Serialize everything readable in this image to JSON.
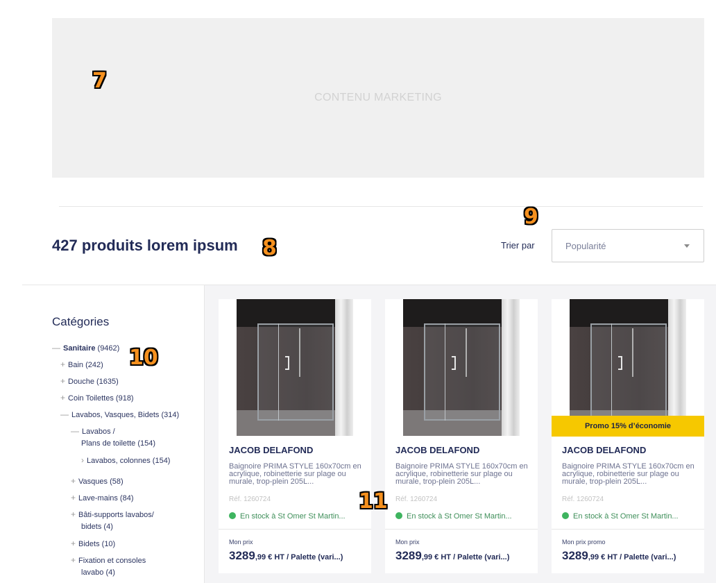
{
  "marketing": {
    "text": "CONTENU MARKETING"
  },
  "annotations": {
    "a7": "7",
    "a8": "8",
    "a9": "9",
    "a10": "10",
    "a11": "11"
  },
  "results": {
    "title": "427 produits lorem ipsum"
  },
  "sort": {
    "label": "Trier par",
    "value": "Popularité"
  },
  "sidebar": {
    "title": "Catégories",
    "items": [
      {
        "sym": "—",
        "name": "Sanitaire",
        "count": " (9462)"
      },
      {
        "sym": "+",
        "name": "Bain",
        "count": " (242)"
      },
      {
        "sym": "+",
        "name": "Douche",
        "count": " (1635)"
      },
      {
        "sym": "+",
        "name": "Coin Toilettes",
        "count": " (918)"
      },
      {
        "sym": "—",
        "name": "Lavabos, Vasques, Bidets",
        "count": " (314)"
      },
      {
        "sym": "—",
        "name": "Lavabos /",
        "count": ""
      },
      {
        "sym": "",
        "name": "Plans de toilette",
        "count": " (154)"
      },
      {
        "sym": "›",
        "name": "Lavabos, colonnes",
        "count": " (154)"
      },
      {
        "sym": "+",
        "name": "Vasques",
        "count": " (58)"
      },
      {
        "sym": "+",
        "name": "Lave-mains",
        "count": " (84)"
      },
      {
        "sym": "+",
        "name": "Bâti-supports lavabos/",
        "count": ""
      },
      {
        "sym": "",
        "name": "bidets",
        "count": " (4)"
      },
      {
        "sym": "+",
        "name": "Bidets",
        "count": " (10)"
      },
      {
        "sym": "+",
        "name": "Fixation et consoles",
        "count": ""
      },
      {
        "sym": "",
        "name": "lavabo",
        "count": " (4)"
      }
    ]
  },
  "products": [
    {
      "brand": "JACOB DELAFOND",
      "desc": "Baignoire PRIMA STYLE 160x70cm en acrylique, robinetterie sur plage ou murale, trop-plein 205L...",
      "ref": "Réf. 1260724",
      "stock": "En stock à St Omer St Martin...",
      "price_label": "Mon prix",
      "price_int": "3289",
      "price_rest": ",99 € HT / Palette (vari...)",
      "promo": ""
    },
    {
      "brand": "JACOB DELAFOND",
      "desc": "Baignoire PRIMA STYLE 160x70cm en acrylique, robinetterie sur plage ou murale, trop-plein 205L...",
      "ref": "Réf. 1260724",
      "stock": "En stock à St Omer St Martin...",
      "price_label": "Mon prix",
      "price_int": "3289",
      "price_rest": ",99 € HT / Palette (vari...)",
      "promo": ""
    },
    {
      "brand": "JACOB DELAFOND",
      "desc": "Baignoire PRIMA STYLE 160x70cm en acrylique, robinetterie sur plage ou murale, trop-plein 205L...",
      "ref": "Réf. 1260724",
      "stock": "En stock à St Omer St Martin...",
      "price_label": "Mon prix promo",
      "price_int": "3289",
      "price_rest": ",99 € HT / Palette (vari...)",
      "promo": "Promo 15% d’économie"
    }
  ],
  "colors": {
    "accent": "#222b57",
    "promo": "#f6c800",
    "stock": "#3eb45f"
  }
}
